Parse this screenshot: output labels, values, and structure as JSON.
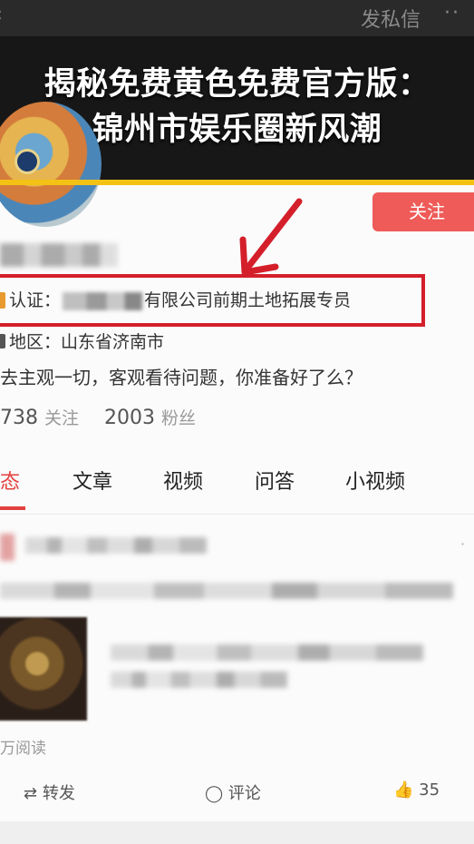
{
  "header": {
    "dm_label": "发私信",
    "more_icon": "more-icon",
    "back_icon": "back-icon",
    "banner_line1": "揭秘免费黄色免费官方版：",
    "banner_line2": "锦州市娱乐圈新风潮",
    "accent_color": "#f3c214"
  },
  "profile": {
    "follow_label": "关注",
    "follow_color": "#ee5b58",
    "verify_prefix": "认证：",
    "verify_suffix": "有限公司前期土地拓展专员",
    "region": "地区：山东省济南市",
    "bio": "去主观一切，客观看待问题，你准备好了么？",
    "following_count": "738",
    "following_label": "关注",
    "followers_count": "2003",
    "followers_label": "粉丝"
  },
  "tabs": [
    {
      "label": "动态",
      "visible": "态",
      "active": true
    },
    {
      "label": "文章"
    },
    {
      "label": "视频"
    },
    {
      "label": "问答"
    },
    {
      "label": "小视频"
    }
  ],
  "post": {
    "reads": "万阅读",
    "actions": {
      "share_label": "转发",
      "comment_label": "评论",
      "like_count": "35"
    }
  },
  "highlight_color": "#d41f2a"
}
